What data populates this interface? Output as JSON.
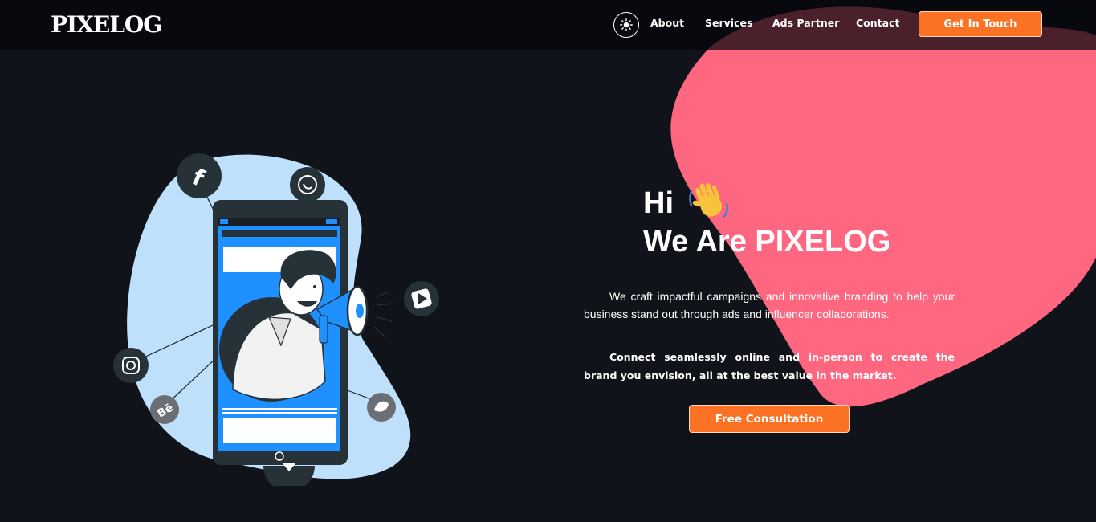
{
  "nav": {
    "logo": "PIXELOG",
    "links": [
      "About",
      "Services",
      "Ads Partner",
      "Contact"
    ],
    "cta": "Get In Touch",
    "theme_icon": "sun-icon"
  },
  "hero": {
    "greeting": "Hi",
    "wave_icon": "waving-hand-icon",
    "title": "We Are PIXELOG",
    "paragraph_1": "We craft impactful campaigns and innovative branding to help your business stand out through ads and influencer collaborations.",
    "paragraph_2": "Connect seamlessly online and in-person to create the brand you envision, all at the best value in the market.",
    "button": "Free Consultation"
  },
  "illustration": {
    "icons": [
      "facebook-icon",
      "whatsapp-icon",
      "youtube-icon",
      "instagram-icon",
      "behance-icon",
      "bird-icon",
      "chat-icon"
    ]
  },
  "colors": {
    "background": "#11131a",
    "accent": "#fb7224",
    "blob": "#ff6680",
    "illustration_blue": "#1e90ff",
    "illustration_light": "#bfe0fb"
  }
}
